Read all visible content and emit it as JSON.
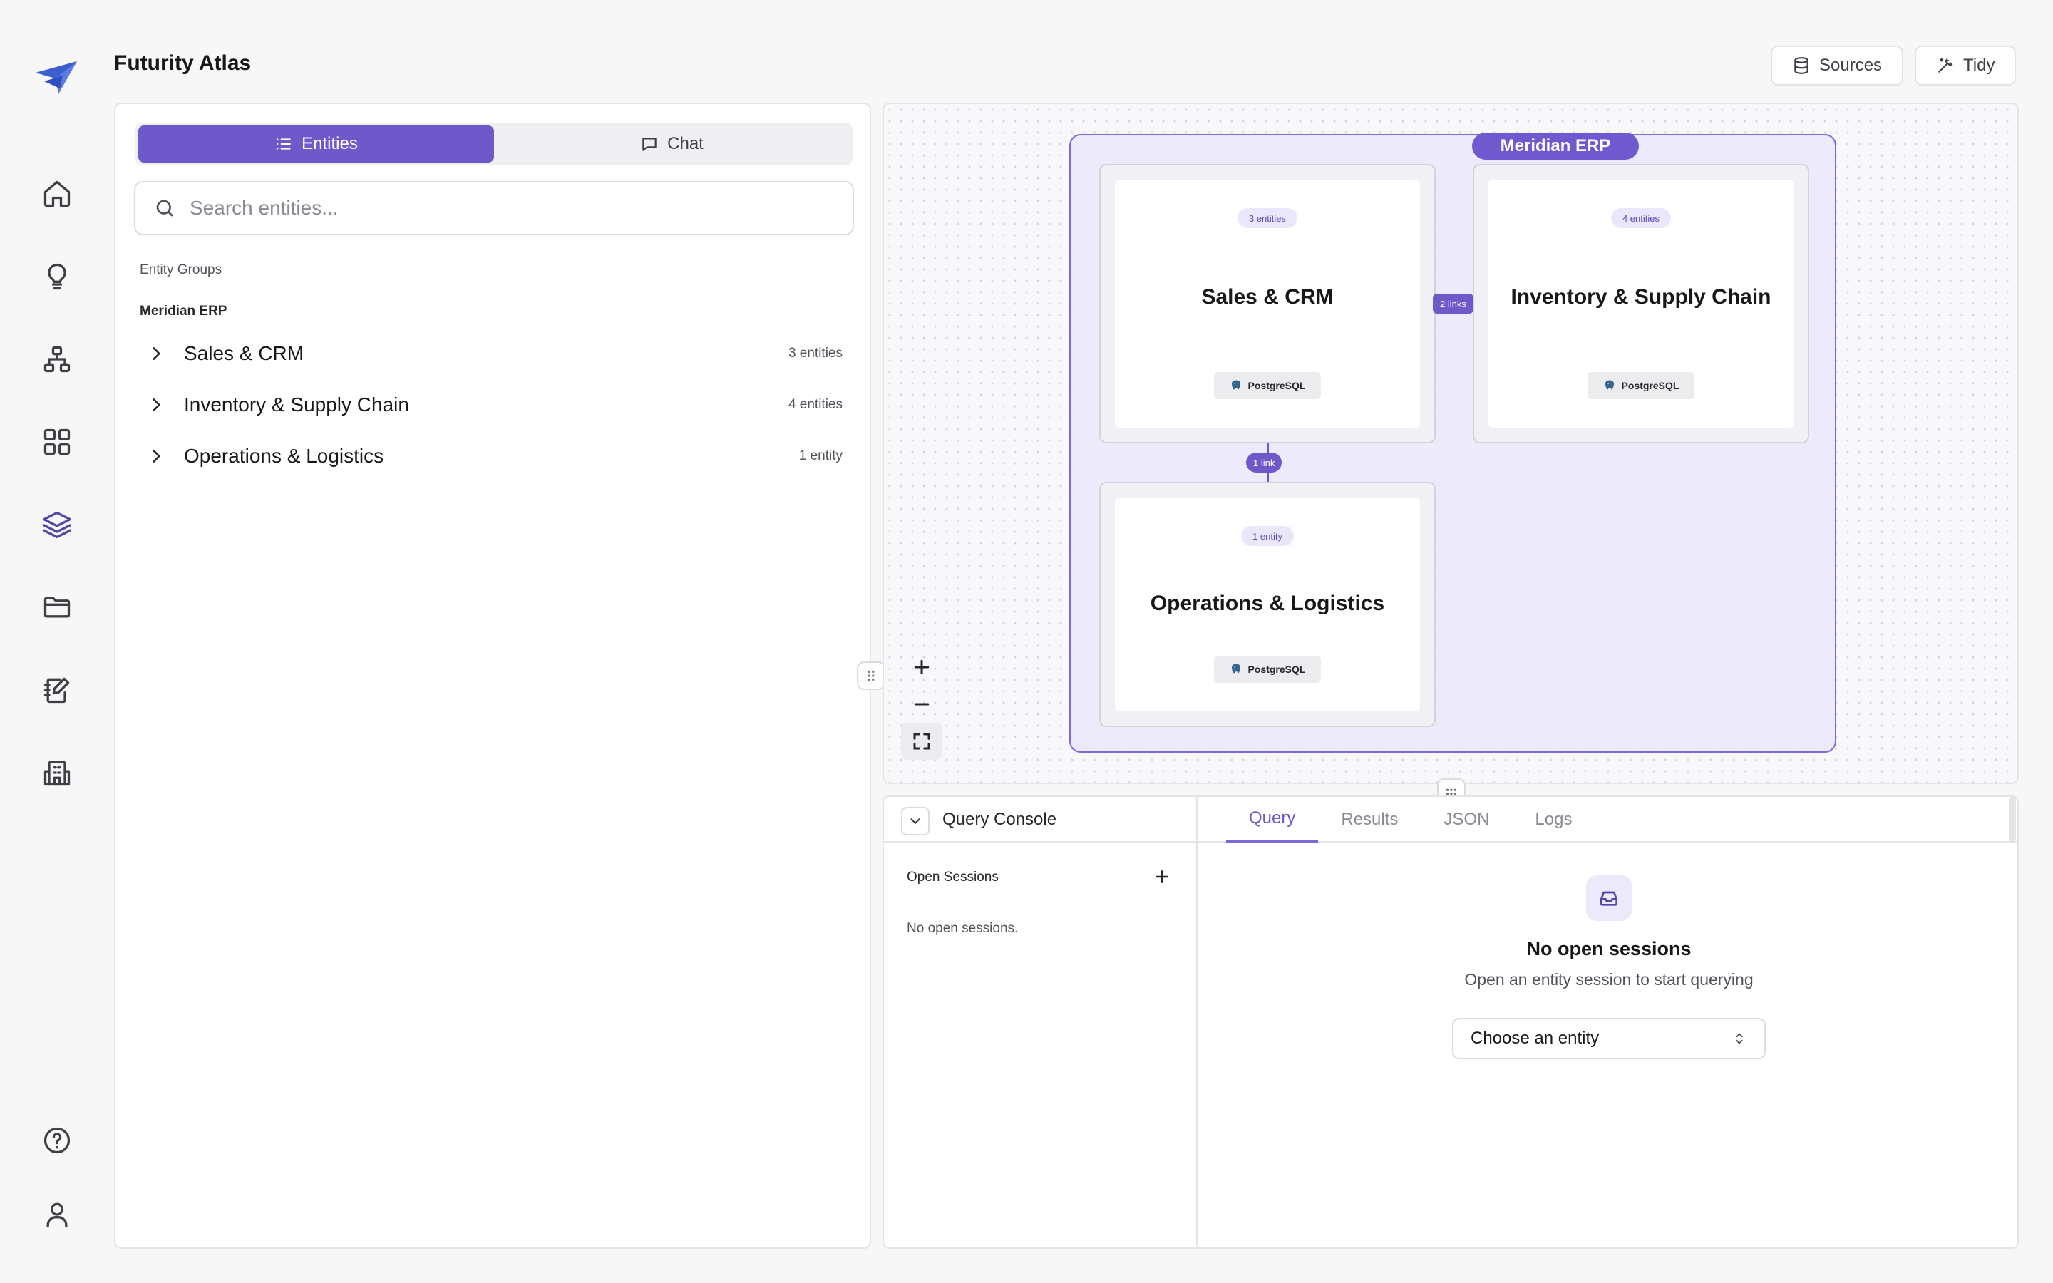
{
  "app": {
    "title": "Futurity Atlas"
  },
  "header": {
    "sources_label": "Sources",
    "tidy_label": "Tidy"
  },
  "rail": {
    "items": [
      {
        "icon": "home-icon"
      },
      {
        "icon": "lightbulb-icon"
      },
      {
        "icon": "hierarchy-icon"
      },
      {
        "icon": "grid-icon"
      },
      {
        "icon": "layers-icon",
        "active": true
      },
      {
        "icon": "folder-icon"
      },
      {
        "icon": "edit-icon"
      },
      {
        "icon": "building-icon"
      }
    ],
    "bottom": [
      {
        "icon": "help-icon"
      },
      {
        "icon": "user-icon"
      }
    ]
  },
  "sidebar": {
    "tabs": [
      {
        "label": "Entities",
        "active": true
      },
      {
        "label": "Chat"
      }
    ],
    "search_placeholder": "Search entities...",
    "groups_heading": "Entity Groups",
    "source_name": "Meridian ERP",
    "groups": [
      {
        "name": "Sales & CRM",
        "count": "3 entities"
      },
      {
        "name": "Inventory & Supply Chain",
        "count": "4 entities"
      },
      {
        "name": "Operations & Logistics",
        "count": "1 entity"
      }
    ]
  },
  "canvas": {
    "group_label": "Meridian ERP",
    "nodes": [
      {
        "title": "Sales & CRM",
        "badge": "3 entities",
        "db": "PostgreSQL"
      },
      {
        "title": "Inventory & Supply Chain",
        "badge": "4 entities",
        "db": "PostgreSQL"
      },
      {
        "title": "Operations & Logistics",
        "badge": "1 entity",
        "db": "PostgreSQL"
      }
    ],
    "links": [
      {
        "label": "2 links"
      },
      {
        "label": "1 link"
      }
    ]
  },
  "console": {
    "title": "Query Console",
    "sessions_heading": "Open Sessions",
    "no_sessions_small": "No open sessions.",
    "tabs": [
      {
        "label": "Query",
        "active": true
      },
      {
        "label": "Results"
      },
      {
        "label": "JSON"
      },
      {
        "label": "Logs"
      }
    ],
    "empty_title": "No open sessions",
    "empty_sub": "Open an entity session to start querying",
    "select_label": "Choose an entity"
  },
  "colors": {
    "accent": "#6f58c9",
    "group_fill": "#ebe8fc",
    "background": "#f7f7f8"
  }
}
